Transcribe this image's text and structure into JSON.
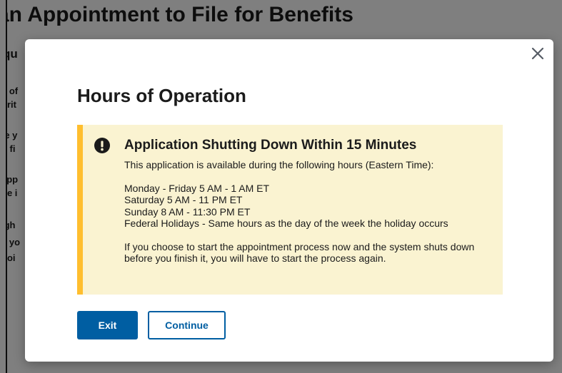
{
  "background": {
    "title": "an Appointment to File for Benefits",
    "subhead": "qu",
    "fragments": [
      "s of",
      "urit",
      "te y",
      "o fi",
      "app",
      "he i",
      "igh",
      "e yo",
      "poi"
    ]
  },
  "modal": {
    "heading": "Hours of Operation",
    "close_glyph": "×",
    "alert": {
      "heading": "Application Shutting Down Within 15 Minutes",
      "intro": "This application is available during the following hours (Eastern Time):",
      "hours": [
        "Monday - Friday 5 AM - 1 AM ET",
        "Saturday 5 AM - 11 PM ET",
        "Sunday 8 AM - 11:30 PM ET",
        "Federal Holidays - Same hours as the day of the week the holiday occurs"
      ],
      "warning": "If you choose to start the appointment process now and the system shuts down before you finish it, you will have to start the process again."
    },
    "buttons": {
      "exit": "Exit",
      "continue": "Continue"
    }
  },
  "colors": {
    "primary": "#005ea2",
    "alert_bg": "#faf3d1",
    "alert_border": "#ffbe2e",
    "text": "#1b1b1b"
  },
  "icons": {
    "alert": "exclamation-circle-icon",
    "close": "close-icon"
  }
}
